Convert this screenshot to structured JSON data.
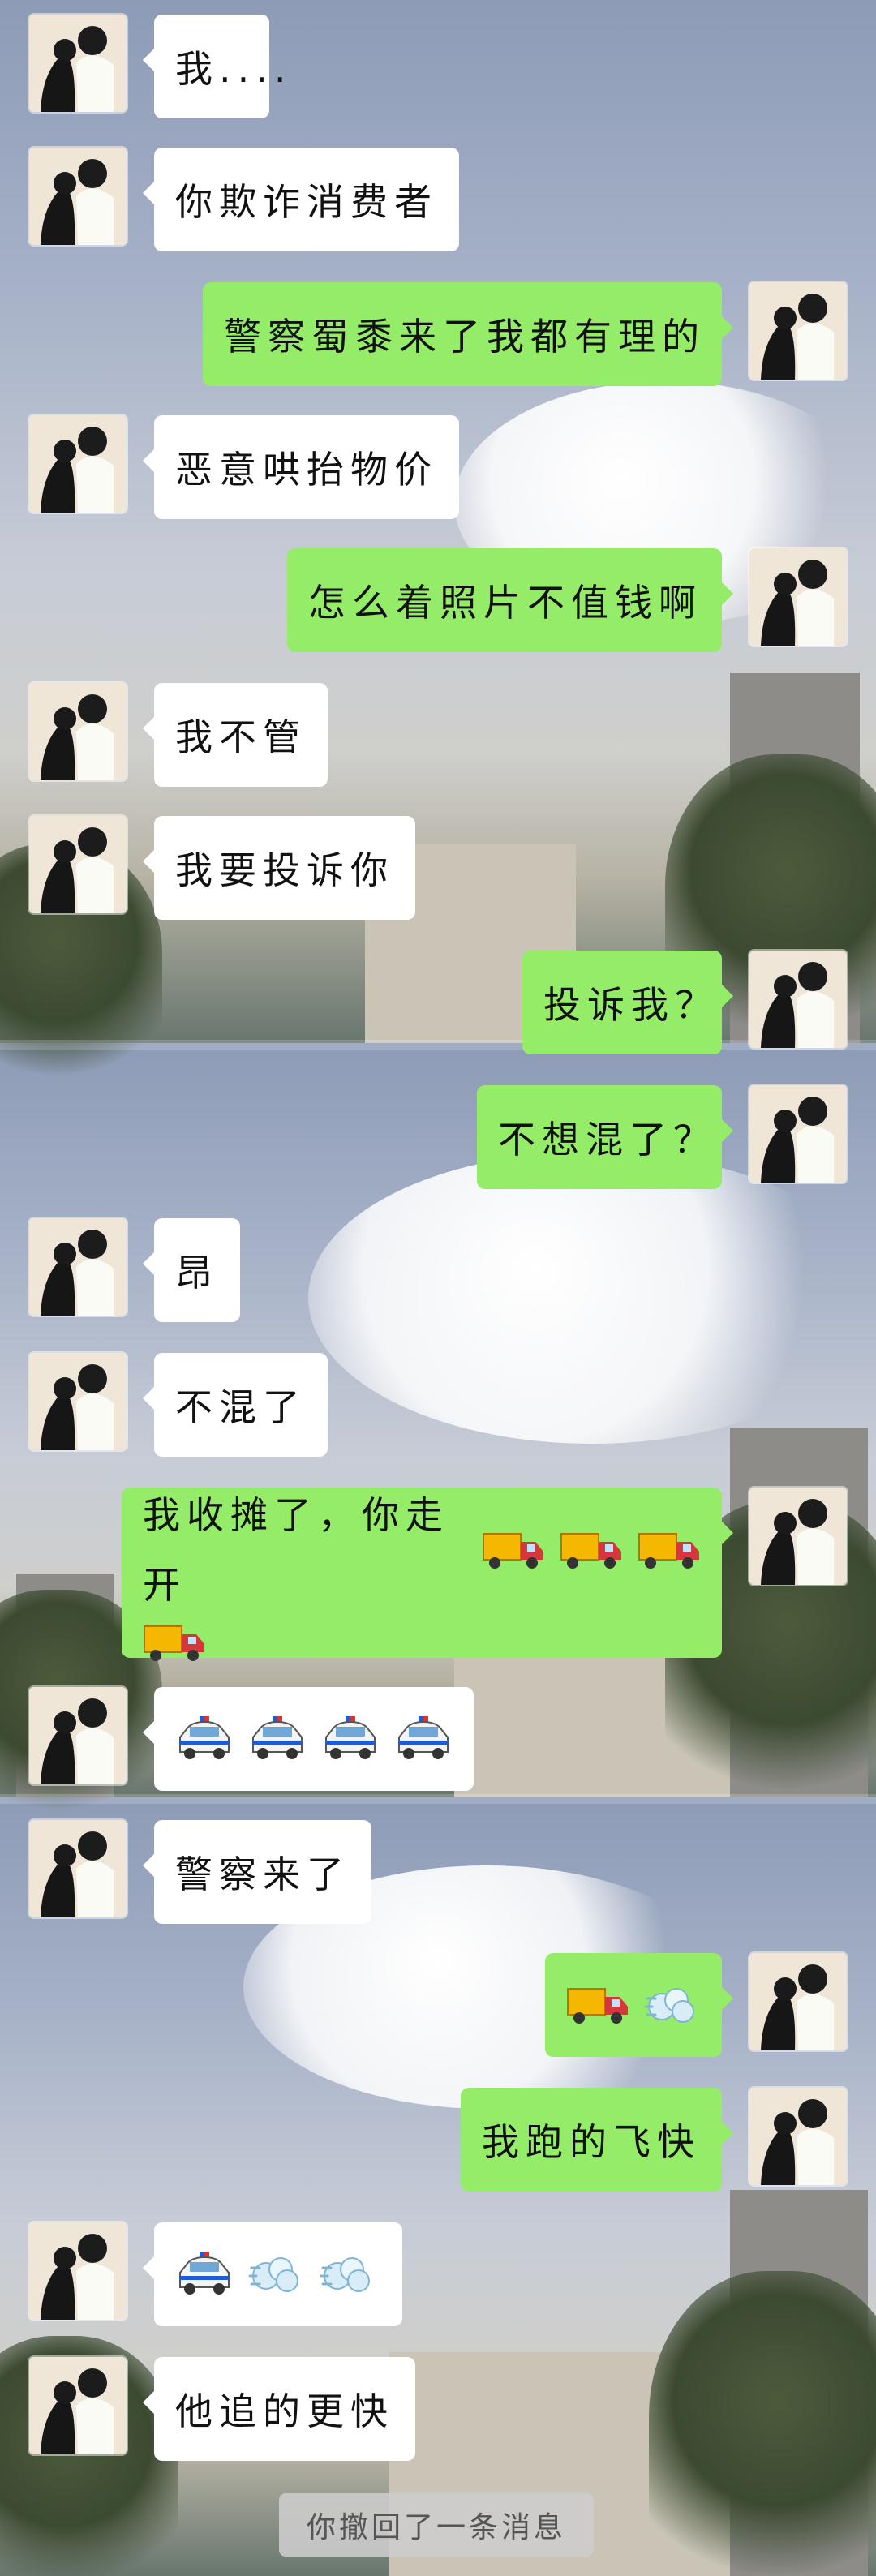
{
  "colors": {
    "incoming_bubble": "#ffffff",
    "outgoing_bubble": "#95ec69",
    "recall_notice_bg": "#cdcdcd"
  },
  "messages": [
    {
      "sender": "contact",
      "text": "我...."
    },
    {
      "sender": "contact",
      "text": "你欺诈消费者"
    },
    {
      "sender": "me",
      "text": "警察蜀黍来了我都有理的"
    },
    {
      "sender": "contact",
      "text": "恶意哄抬物价"
    },
    {
      "sender": "me",
      "text": "怎么着照片不值钱啊"
    },
    {
      "sender": "contact",
      "text": "我不管"
    },
    {
      "sender": "contact",
      "text": "我要投诉你"
    },
    {
      "sender": "me",
      "text": "投诉我？"
    },
    {
      "sender": "me",
      "text": "不想混了？"
    },
    {
      "sender": "contact",
      "text": "昂"
    },
    {
      "sender": "contact",
      "text": "不混了"
    },
    {
      "sender": "me",
      "text": "我收摊了，你走开",
      "emojis": [
        "delivery-truck",
        "delivery-truck",
        "delivery-truck",
        "delivery-truck"
      ]
    },
    {
      "sender": "contact",
      "emojis": [
        "police-car",
        "police-car",
        "police-car",
        "police-car"
      ]
    },
    {
      "sender": "contact",
      "text": "警察来了"
    },
    {
      "sender": "me",
      "emojis": [
        "delivery-truck",
        "dash"
      ]
    },
    {
      "sender": "me",
      "text": "我跑的飞快"
    },
    {
      "sender": "contact",
      "emojis": [
        "police-car",
        "dash",
        "dash"
      ]
    },
    {
      "sender": "contact",
      "text": "他追的更快"
    }
  ],
  "recall_notice": "你撤回了一条消息"
}
